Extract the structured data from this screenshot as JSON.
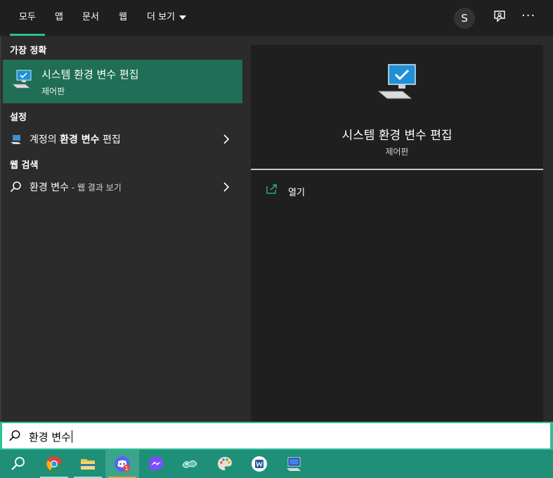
{
  "tabs": {
    "all": "모두",
    "apps": "앱",
    "documents": "문서",
    "web": "웹",
    "more": "더 보기"
  },
  "header": {
    "avatar_letter": "S",
    "feedback_icon": "feedback-icon",
    "more_icon_text": "···"
  },
  "left_panel": {
    "best_match_label": "가장 정확",
    "best_match": {
      "title": "시스템 환경 변수 편집",
      "subtitle": "제어판",
      "icon": "monitor-settings-icon"
    },
    "settings_label": "설정",
    "settings_item": {
      "prefix": "계정의 ",
      "bold": "환경 변수",
      "suffix": " 편집",
      "icon": "laptop-icon"
    },
    "web_search_label": "웹 검색",
    "web_item": {
      "query": "환경 변수",
      "suffix": " - 웹 결과 보기",
      "icon": "search-icon"
    }
  },
  "right_panel": {
    "title": "시스템 환경 변수 편집",
    "subtitle": "제어판",
    "open_label": "열기"
  },
  "search": {
    "value": "환경 변수"
  },
  "taskbar": {
    "items": [
      "search-icon",
      "chrome-icon",
      "file-explorer-icon",
      "discord-icon",
      "messenger-icon",
      "app-icon",
      "paint-icon",
      "word-icon",
      "system-icon"
    ],
    "discord_badge": "1"
  },
  "colors": {
    "accent": "#2bbf94",
    "selected": "#1f6e55",
    "taskbar": "#1f8f78"
  }
}
